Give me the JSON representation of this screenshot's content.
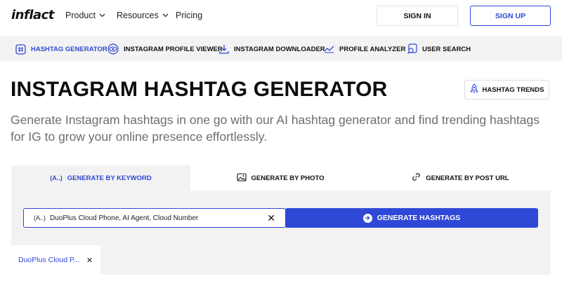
{
  "brand": {
    "logo_text": "inflact",
    "accent": "#2f48d6"
  },
  "nav": {
    "items": [
      {
        "label": "Product",
        "has_dropdown": true
      },
      {
        "label": "Resources",
        "has_dropdown": true
      },
      {
        "label": "Pricing",
        "has_dropdown": false
      }
    ],
    "sign_in": "SIGN IN",
    "sign_up": "SIGN UP"
  },
  "tools": [
    {
      "label": "HASHTAG GENERATOR",
      "icon": "hashtag-icon",
      "active": true
    },
    {
      "label": "INSTAGRAM PROFILE VIEWER",
      "icon": "eye-icon",
      "active": false
    },
    {
      "label": "INSTAGRAM DOWNLOADER",
      "icon": "download-icon",
      "active": false
    },
    {
      "label": "PROFILE ANALYZER",
      "icon": "trend-line-icon",
      "active": false
    },
    {
      "label": "USER SEARCH",
      "icon": "user-search-icon",
      "active": false
    }
  ],
  "page": {
    "title": "INSTAGRAM HASHTAG GENERATOR",
    "trends_button": "HASHTAG TRENDS",
    "subtitle": "Generate Instagram hashtags in one go with our AI hashtag generator and find trending hashtags for IG to grow your online presence effortlessly."
  },
  "generator": {
    "tabs": [
      {
        "label": "GENERATE BY KEYWORD",
        "icon": "keyword-icon",
        "active": true
      },
      {
        "label": "GENERATE BY PHOTO",
        "icon": "image-icon",
        "active": false
      },
      {
        "label": "GENERATE BY POST URL",
        "icon": "link-icon",
        "active": false
      }
    ],
    "keyword_icon_text": "(A..)",
    "input_value": "DuoPlus Cloud Phone, AI Agent, Cloud Number",
    "clear_symbol": "✕",
    "generate_button": "GENERATE HASHTAGS",
    "chips": [
      {
        "label": "DuoPlus Cloud P..."
      }
    ]
  }
}
